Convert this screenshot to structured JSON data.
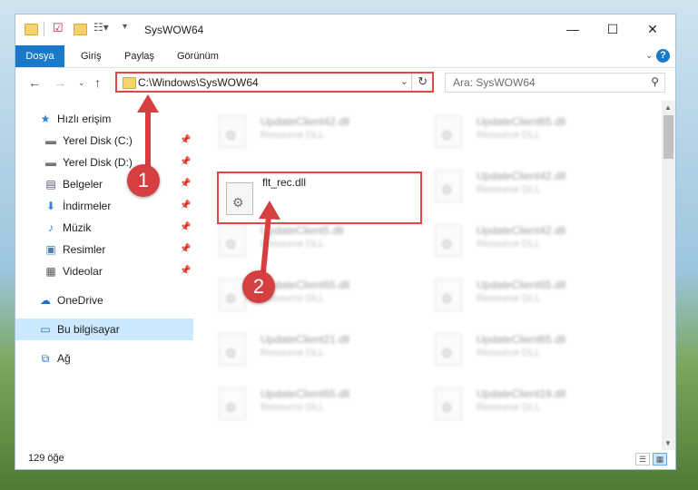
{
  "window": {
    "title": "SysWOW64",
    "controls": {
      "minimize": "—",
      "maximize": "☐",
      "close": "✕"
    }
  },
  "ribbon": {
    "tabs": [
      "Dosya",
      "Giriş",
      "Paylaş",
      "Görünüm"
    ],
    "help": "?"
  },
  "address": {
    "path": "C:\\Windows\\SysWOW64"
  },
  "search": {
    "placeholder": "Ara: SysWOW64"
  },
  "sidebar": {
    "items": [
      {
        "label": "Hızlı erişim",
        "icon": "star-icon"
      },
      {
        "label": "Yerel Disk (C:)",
        "icon": "drive-icon",
        "pinned": true
      },
      {
        "label": "Yerel Disk (D:)",
        "icon": "drive-icon",
        "pinned": true
      },
      {
        "label": "Belgeler",
        "icon": "document-icon",
        "pinned": true
      },
      {
        "label": "İndirmeler",
        "icon": "download-icon",
        "pinned": true
      },
      {
        "label": "Müzik",
        "icon": "music-icon",
        "pinned": true
      },
      {
        "label": "Resimler",
        "icon": "picture-icon",
        "pinned": true
      },
      {
        "label": "Videolar",
        "icon": "video-icon",
        "pinned": true
      },
      {
        "label": "OneDrive",
        "icon": "cloud-icon"
      },
      {
        "label": "Bu bilgisayar",
        "icon": "computer-icon",
        "selected": true
      },
      {
        "label": "Ağ",
        "icon": "network-icon"
      }
    ]
  },
  "files": {
    "type_label": "Resource DLL",
    "highlighted": {
      "name": "flt_rec.dll"
    },
    "left_column": [
      "UpdateClient42.dll",
      "UpdateClient5.dll",
      "UpdateClient65.dll",
      "UpdateClient21.dll",
      "UpdateClient65.dll"
    ],
    "right_column": [
      "UpdateClient65.dll",
      "UpdateClient42.dll",
      "UpdateClient42.dll",
      "UpdateClient65.dll",
      "UpdateClient65.dll",
      "UpdateClient19.dll"
    ]
  },
  "status": {
    "count": "129 öğe"
  },
  "callouts": [
    "1",
    "2"
  ],
  "colors": {
    "accent": "#1979ca",
    "highlight": "#e24646",
    "callout": "#d63f3f",
    "selected": "#cce8ff"
  }
}
